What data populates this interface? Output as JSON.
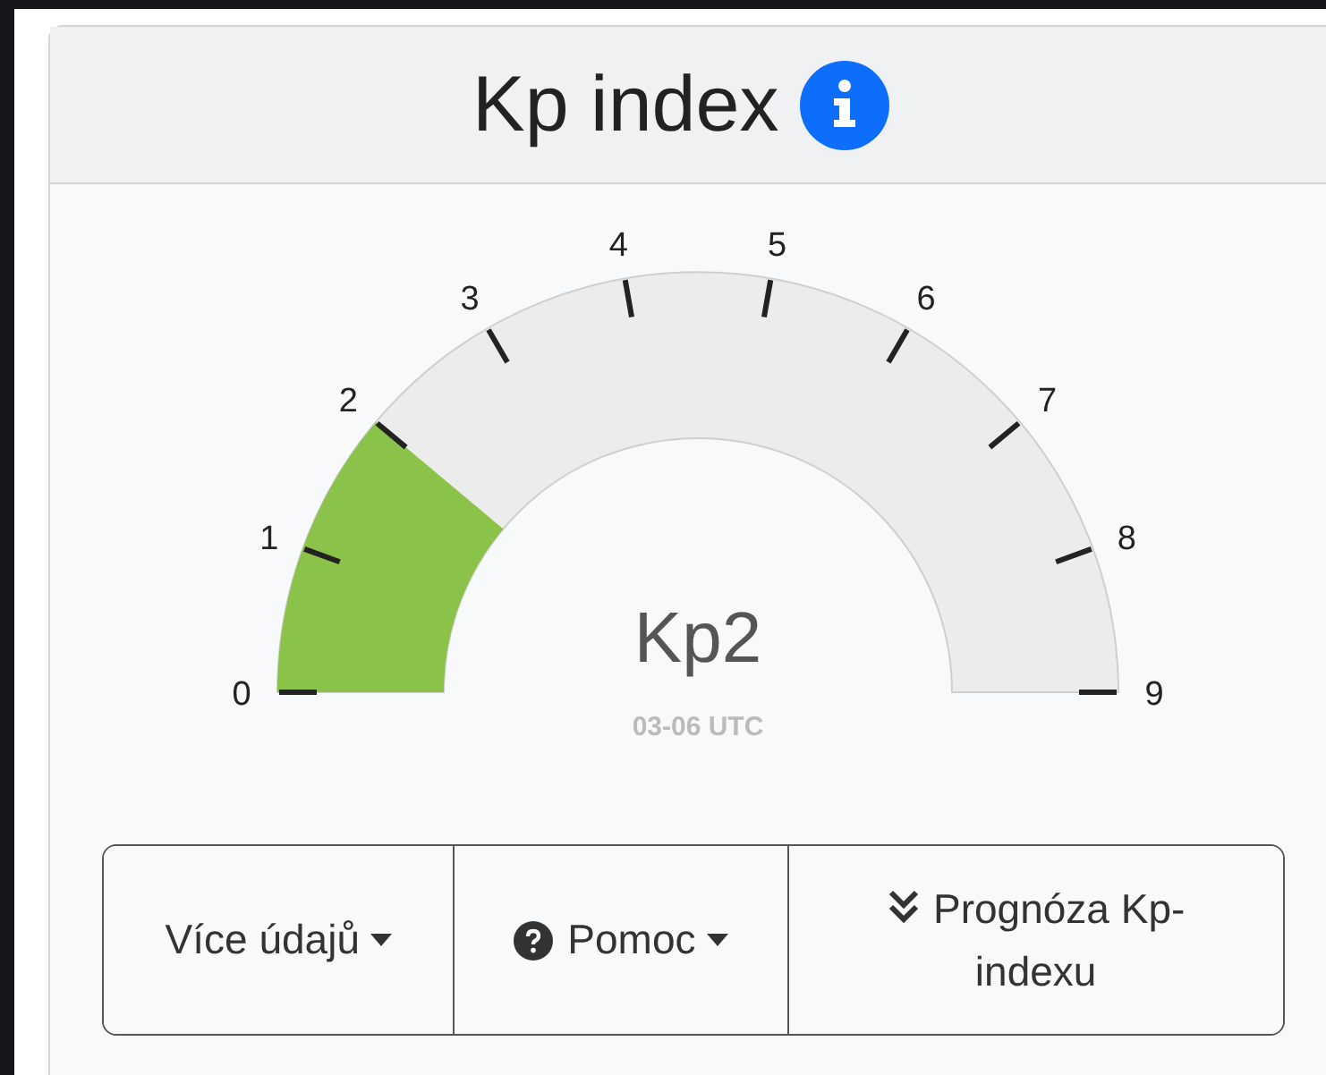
{
  "card": {
    "title": "Kp index"
  },
  "gauge": {
    "level": 0.2222,
    "reading": "Kp2",
    "time": "03-06 UTC",
    "scale": [
      "0",
      "1",
      "2",
      "3",
      "4",
      "5",
      "6",
      "7",
      "8",
      "9"
    ]
  },
  "buttons": [
    {
      "kind": "dropdown",
      "label": "Více údajů"
    },
    {
      "kind": "help-dropdown",
      "label": "Pomoc"
    },
    {
      "kind": "expand",
      "label": "Prognóza Kp-indexu"
    }
  ]
}
